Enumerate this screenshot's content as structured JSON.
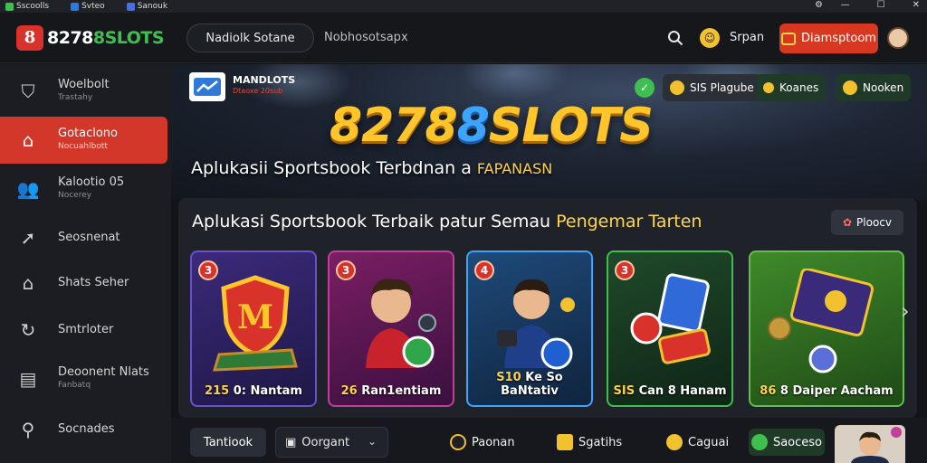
{
  "titlebar": {
    "items": [
      "Sscoolls",
      "Svteo",
      "Sanouk"
    ],
    "controls": [
      "—",
      "☐",
      "✕"
    ]
  },
  "header": {
    "logo_mark": "8",
    "logo_text_a": "8278",
    "logo_text_b": "8SLOTS",
    "nav_pill": "Nadiolk Sotane",
    "nav_link": "Nobhosotsapx",
    "user_label": "Srpan",
    "deposit_label": "Diamsptoom"
  },
  "sidebar": {
    "items": [
      {
        "label": "Woelbolt",
        "sub": "Trastahy",
        "icon": "shield-icon",
        "glyph": "⛉"
      },
      {
        "label": "Gotaclono",
        "sub": "Nocuahlbott",
        "icon": "home-icon",
        "glyph": "⌂"
      },
      {
        "label": "Kalootio 05",
        "sub": "Nocerey",
        "icon": "users-icon",
        "glyph": "👥"
      },
      {
        "label": "Seosnenat",
        "sub": "",
        "icon": "arrow-icon",
        "glyph": "➚"
      },
      {
        "label": "Shats Seher",
        "sub": "",
        "icon": "house-icon",
        "glyph": "⌂"
      },
      {
        "label": "Smtrloter",
        "sub": "",
        "icon": "refresh-icon",
        "glyph": "↻"
      },
      {
        "label": "Deoonent Nlats",
        "sub": "Fanbatq",
        "icon": "document-icon",
        "glyph": "▤"
      },
      {
        "label": "Socnades",
        "sub": "",
        "icon": "search-icon",
        "glyph": "⚲"
      }
    ]
  },
  "hero": {
    "badge_text": "MANDLOTS",
    "badge_sub": "Dtaoxe 20sub",
    "title_a": "8278",
    "title_b": "8",
    "title_c": "SLOTS",
    "subtitle": "Aplukasii Sportsbook Terbdnan a",
    "subtitle_accent": "FAPANASN",
    "chips": [
      {
        "label": "",
        "color": "#3fbf4f"
      },
      {
        "label": "SIS Plagube",
        "color": "#f2c12e"
      },
      {
        "label": "Koanes",
        "color": "#f2c12e"
      },
      {
        "label": "Nooken",
        "color": "#f2c12e"
      }
    ]
  },
  "panel": {
    "title": "Aplukasi Sportsbook Terbaik patur Semau",
    "title_accent": "Pengemar Tarten",
    "button_label": "Ploocv",
    "button_icon": "✿",
    "cards": [
      {
        "num": "3",
        "label_a": "215",
        "label_b": "0: Nantam",
        "theme": "purple"
      },
      {
        "num": "3",
        "label_a": "26",
        "label_b": "Ran1entiam",
        "theme": "magenta"
      },
      {
        "num": "4",
        "label_a": "S10",
        "label_b": "Ke So BaNtativ",
        "theme": "blue"
      },
      {
        "num": "3",
        "label_a": "SIS",
        "label_b": "Can 8 Hanam",
        "theme": "green"
      },
      {
        "num": "",
        "label_a": "86",
        "label_b": "8 Daiper Aacham",
        "theme": "field"
      }
    ]
  },
  "bottom": {
    "tab": "Tantiook",
    "select": "Oorgant",
    "items": [
      {
        "label": "Paonan",
        "color": "#f2c12e"
      },
      {
        "label": "Sgatihs",
        "color": "#f2c12e"
      },
      {
        "label": "Caguai",
        "color": "#f2c12e"
      }
    ],
    "green_button": "Saoceso"
  },
  "colors": {
    "accent_red": "#d2372a",
    "accent_gold": "#ffc52b",
    "accent_green": "#3fbf4f"
  }
}
